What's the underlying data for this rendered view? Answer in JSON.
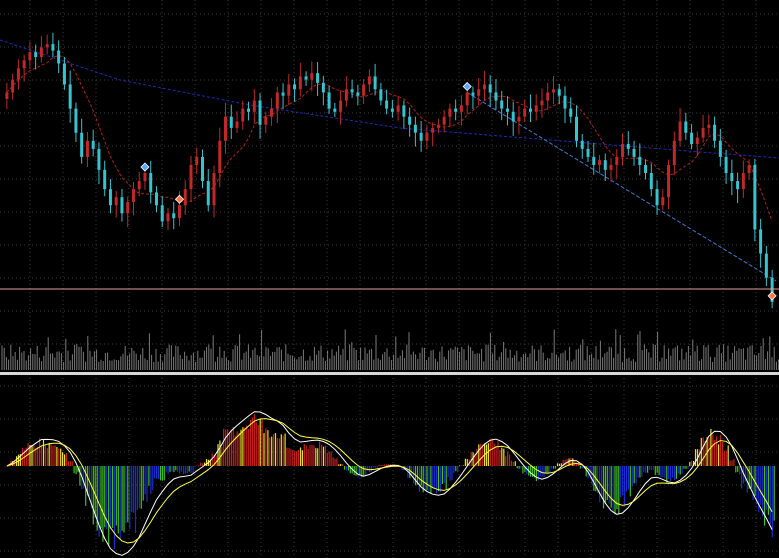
{
  "colors": {
    "background": "#000000",
    "grid": "#3a3a3a",
    "candle_bull": "#c0282a",
    "candle_bear": "#35c4d0",
    "ma_line": "#b01e1e",
    "slow_ma": "#1a2bb0",
    "trend_line": "#3d7fd6",
    "price_line": "#e89a9a",
    "volume": "#7a7a7a",
    "separator": "#d8d8d8",
    "hist_pos_strong": "#c81e1e",
    "hist_pos_weak": "#e8e020",
    "hist_neg_strong": "#1a2ed0",
    "hist_neg_weak": "#40c020",
    "osc_line_1": "#ffffff",
    "osc_line_2": "#ffff40",
    "marker_buy": "#5aa8ff",
    "marker_sell": "#ff7a4a"
  },
  "chart_data": [
    {
      "type": "candlestick",
      "panel": "price",
      "series": [
        {
          "role": "candles",
          "close": [
            70,
            78,
            85,
            90,
            95,
            92,
            98,
            100,
            96,
            88,
            75,
            60,
            45,
            30,
            40,
            35,
            22,
            10,
            0,
            5,
            -5,
            2,
            10,
            15,
            20,
            8,
            0,
            -10,
            -5,
            -8,
            0,
            10,
            25,
            30,
            15,
            0,
            20,
            40,
            55,
            48,
            52,
            60,
            58,
            65,
            50,
            55,
            60,
            70,
            68,
            75,
            72,
            80,
            78,
            82,
            76,
            70,
            60,
            58,
            65,
            72,
            70,
            68,
            75,
            80,
            72,
            65,
            60,
            58,
            62,
            55,
            50,
            45,
            40,
            45,
            48,
            50,
            55,
            60,
            58,
            62,
            70,
            68,
            72,
            75,
            70,
            65,
            60,
            58,
            52,
            55,
            60,
            58,
            62,
            65,
            70,
            72,
            68,
            60,
            55,
            40,
            35,
            30,
            25,
            28,
            22,
            25,
            30,
            38,
            35,
            30,
            25,
            20,
            10,
            0,
            5,
            25,
            40,
            52,
            45,
            38,
            42,
            48,
            50,
            40,
            30,
            20,
            15,
            10,
            20,
            25,
            -15,
            -30,
            -45,
            -60
          ]
        },
        {
          "role": "ma",
          "name": ""
        },
        {
          "role": "slow_ma",
          "name": ""
        },
        {
          "role": "volume"
        }
      ],
      "markers": [
        {
          "kind": "buy",
          "bar": 24
        },
        {
          "kind": "sell",
          "bar": 30
        },
        {
          "kind": "buy",
          "bar": 80
        },
        {
          "kind": "sell",
          "bar": 138
        }
      ],
      "horizontal_line": {
        "value": -52
      },
      "trend_line": {
        "from_bar": 80,
        "to_bar": 138
      },
      "grid": true,
      "ylim": [
        -70,
        115
      ]
    },
    {
      "type": "bar",
      "panel": "oscillator",
      "series": [
        {
          "role": "histogram"
        },
        {
          "role": "line",
          "name": ""
        },
        {
          "role": "line",
          "name": ""
        }
      ],
      "grid": true,
      "ylim": [
        -1,
        1
      ]
    }
  ]
}
